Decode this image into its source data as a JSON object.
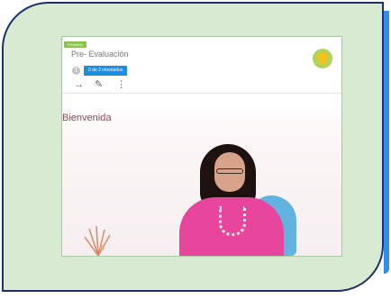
{
  "panel": {
    "tag": "EXAMEN",
    "title": "Pre- Evaluación",
    "attempts": "0 de 2 intentados",
    "tools": {
      "arrow": "→",
      "pencil": "✎",
      "more": "⋮"
    }
  },
  "video": {
    "welcome": "Bienvenida"
  },
  "colors": {
    "card_bg": "#d9ead3",
    "border": "#1f2f6b",
    "accent": "#2f8fe6",
    "tag_green": "#8bc34a",
    "attempts_blue": "#1a8fe3",
    "bulb_green": "#b0d35a",
    "bulb_yellow": "#f2c21b"
  },
  "icons": [
    "info-icon",
    "arrow-right-icon",
    "pencil-icon",
    "more-vert-icon",
    "lightbulb-icon"
  ]
}
